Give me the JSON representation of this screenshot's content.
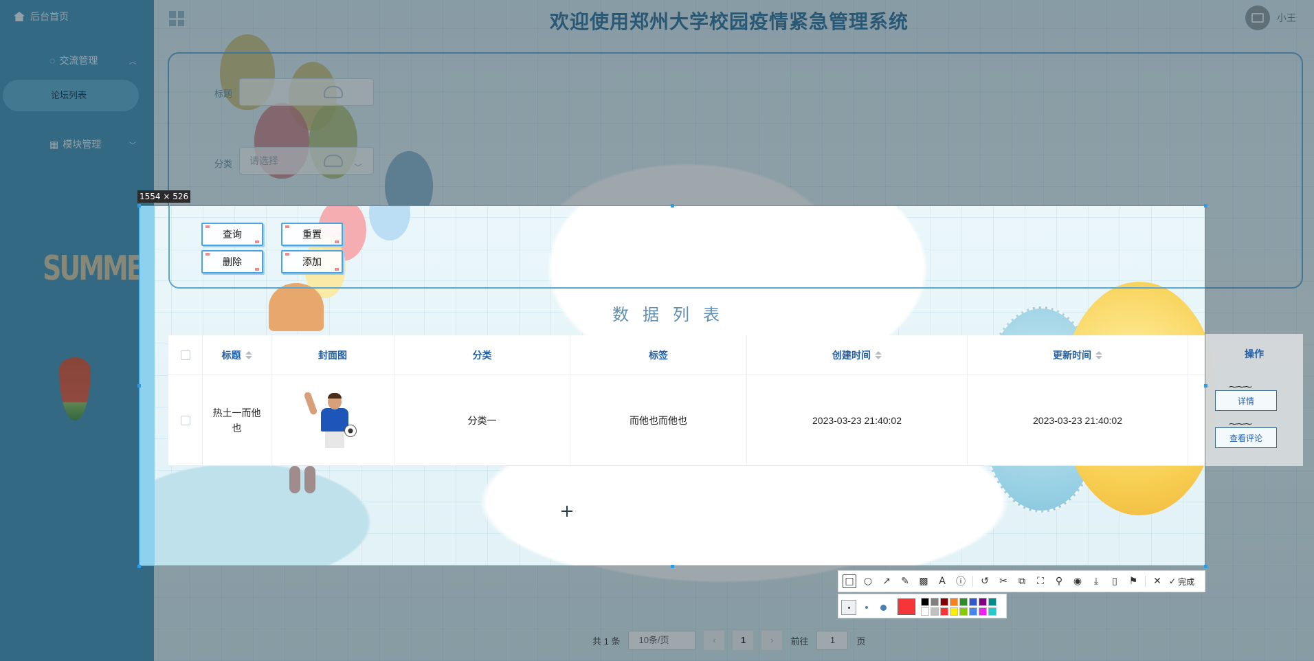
{
  "app": {
    "title": "欢迎使用郑州大学校园疫情紧急管理系统",
    "user": "小王"
  },
  "sidebar": {
    "home": "后台首页",
    "menu1": "交流管理",
    "menu1_sub": "论坛列表",
    "menu2": "模块管理",
    "decor_text": "SUMMER"
  },
  "search": {
    "title_label": "标题",
    "category_label": "分类",
    "category_placeholder": "请选择",
    "query_button": "查询",
    "reset_button": "重置",
    "delete_button": "删除",
    "add_button": "添加"
  },
  "list": {
    "title": "数据列表",
    "columns": [
      "标题",
      "封面图",
      "分类",
      "标签",
      "创建时间",
      "更新时间",
      "操作"
    ],
    "rows": [
      {
        "title": "热土一而他也",
        "category": "分类一",
        "tags": "而他也而他也",
        "created": "2023-03-23 21:40:02",
        "updated": "2023-03-23 21:40:02",
        "detail_button": "详情",
        "comment_button": "查看评论"
      }
    ]
  },
  "pager": {
    "total": "共 1 条",
    "page_size": "10条/页",
    "current_page": "1",
    "goto_label": "前往",
    "goto_value": "1",
    "page_suffix": "页"
  },
  "capture": {
    "size_label": "1554 × 526",
    "done_label": "完成",
    "current_color": "#f5353a",
    "palette": [
      "#000000",
      "#808080",
      "#800000",
      "#f58220",
      "#2e8b2e",
      "#3355cc",
      "#800080",
      "#008b8b",
      "#ffffff",
      "#c0c0c0",
      "#ff3333",
      "#ffee00",
      "#88cc00",
      "#4488ee",
      "#ee22ee",
      "#22cccc"
    ],
    "tools": [
      "rectangle-icon",
      "ellipse-icon",
      "arrow-icon",
      "pen-icon",
      "mosaic-icon",
      "text-icon",
      "number-icon",
      "undo-icon",
      "screenshot-cut-icon",
      "ocr-icon",
      "scroll-capture-icon",
      "pin-icon",
      "record-icon",
      "save-icon",
      "long-capture-icon",
      "bookmark-icon",
      "close-icon",
      "done-icon"
    ]
  }
}
